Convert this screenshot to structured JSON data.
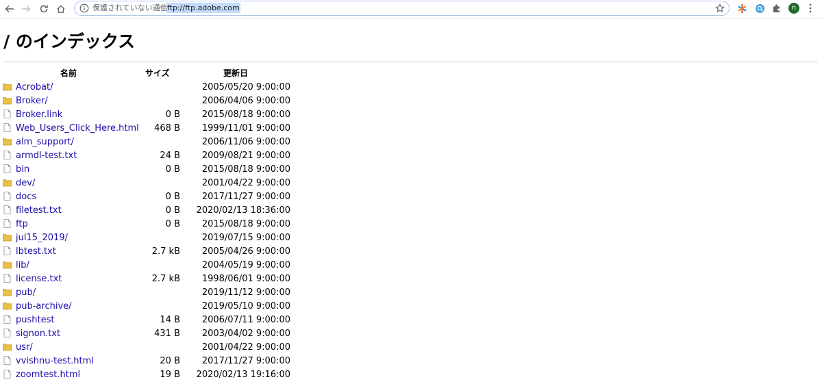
{
  "browser": {
    "security_label": "保護されていない通信",
    "separator": "|",
    "url": "ftp://ftp.adobe.com",
    "profile_initial": "n"
  },
  "page": {
    "title": "/ のインデックス",
    "columns": {
      "name": "名前",
      "size": "サイズ",
      "date": "更新日"
    }
  },
  "files": [
    {
      "name": "Acrobat/",
      "type": "folder",
      "size": "",
      "date": "2005/05/20 9:00:00"
    },
    {
      "name": "Broker/",
      "type": "folder",
      "size": "",
      "date": "2006/04/06 9:00:00"
    },
    {
      "name": "Broker.link",
      "type": "file",
      "size": "0 B",
      "date": "2015/08/18 9:00:00"
    },
    {
      "name": "Web_Users_Click_Here.html",
      "type": "file",
      "size": "468 B",
      "date": "1999/11/01 9:00:00"
    },
    {
      "name": "alm_support/",
      "type": "folder",
      "size": "",
      "date": "2006/11/06 9:00:00"
    },
    {
      "name": "armdl-test.txt",
      "type": "file",
      "size": "24 B",
      "date": "2009/08/21 9:00:00"
    },
    {
      "name": "bin",
      "type": "file",
      "size": "0 B",
      "date": "2015/08/18 9:00:00"
    },
    {
      "name": "dev/",
      "type": "folder",
      "size": "",
      "date": "2001/04/22 9:00:00"
    },
    {
      "name": "docs",
      "type": "file",
      "size": "0 B",
      "date": "2017/11/27 9:00:00"
    },
    {
      "name": "filetest.txt",
      "type": "file",
      "size": "0 B",
      "date": "2020/02/13 18:36:00"
    },
    {
      "name": "ftp",
      "type": "file",
      "size": "0 B",
      "date": "2015/08/18 9:00:00"
    },
    {
      "name": "jul15_2019/",
      "type": "folder",
      "size": "",
      "date": "2019/07/15 9:00:00"
    },
    {
      "name": "lbtest.txt",
      "type": "file",
      "size": "2.7 kB",
      "date": "2005/04/26 9:00:00"
    },
    {
      "name": "lib/",
      "type": "folder",
      "size": "",
      "date": "2004/05/19 9:00:00"
    },
    {
      "name": "license.txt",
      "type": "file",
      "size": "2.7 kB",
      "date": "1998/06/01 9:00:00"
    },
    {
      "name": "pub/",
      "type": "folder",
      "size": "",
      "date": "2019/11/12 9:00:00"
    },
    {
      "name": "pub-archive/",
      "type": "folder",
      "size": "",
      "date": "2019/05/10 9:00:00"
    },
    {
      "name": "pushtest",
      "type": "file",
      "size": "14 B",
      "date": "2006/07/11 9:00:00"
    },
    {
      "name": "signon.txt",
      "type": "file",
      "size": "431 B",
      "date": "2003/04/02 9:00:00"
    },
    {
      "name": "usr/",
      "type": "folder",
      "size": "",
      "date": "2001/04/22 9:00:00"
    },
    {
      "name": "vvishnu-test.html",
      "type": "file",
      "size": "20 B",
      "date": "2017/11/27 9:00:00"
    },
    {
      "name": "zoomtest.html",
      "type": "file",
      "size": "19 B",
      "date": "2020/02/13 19:16:00"
    }
  ],
  "icons": {
    "folder": "folder-icon",
    "file": "file-icon"
  },
  "colors": {
    "link": "#1a0dab",
    "folder": "#e8c04a",
    "url_highlight": "#c4dcf9"
  }
}
